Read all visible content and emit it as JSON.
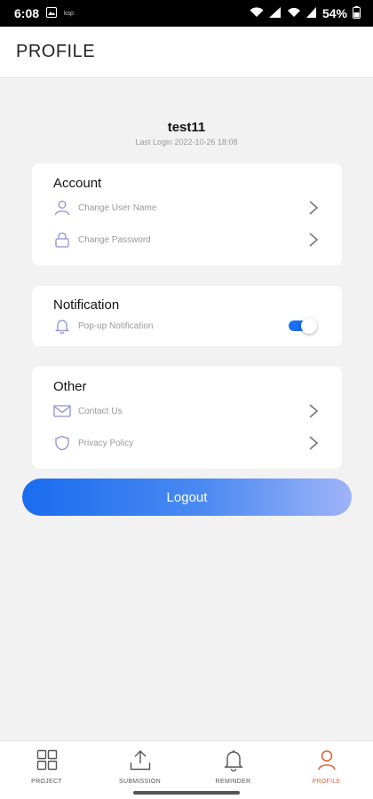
{
  "status_bar": {
    "time": "6:08",
    "small_label": "ksp",
    "battery": "54%"
  },
  "header": {
    "title": "PROFILE"
  },
  "user": {
    "name": "test11",
    "last_login": "Last Login 2022-10-26 18:08"
  },
  "account": {
    "title": "Account",
    "items": [
      {
        "label": "Change User Name",
        "icon": "user-icon"
      },
      {
        "label": "Change Password",
        "icon": "lock-icon"
      }
    ]
  },
  "notification": {
    "title": "Notification",
    "items": [
      {
        "label": "Pop-up Notification",
        "icon": "bell-icon",
        "enabled": true
      }
    ]
  },
  "other": {
    "title": "Other",
    "items": [
      {
        "label": "Contact Us",
        "icon": "mail-icon"
      },
      {
        "label": "Privacy Policy",
        "icon": "shield-icon"
      }
    ]
  },
  "logout_label": "Logout",
  "nav": {
    "items": [
      {
        "label": "PROJECT",
        "icon": "grid-icon"
      },
      {
        "label": "SUBMISSION",
        "icon": "upload-icon"
      },
      {
        "label": "REMINDER",
        "icon": "bell-icon"
      },
      {
        "label": "PROFILE",
        "icon": "person-icon",
        "active": true
      }
    ]
  },
  "colors": {
    "accent": "#1a6ff0",
    "active_nav": "#e0643c",
    "icon_tint": "#8e8ed8"
  }
}
